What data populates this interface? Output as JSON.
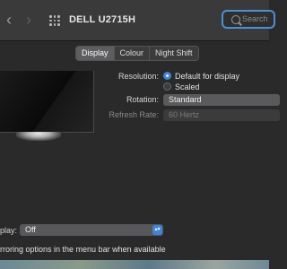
{
  "window": {
    "title": "DELL U2715H",
    "nav_back": "‹",
    "nav_forward": "›",
    "search_placeholder": "Search"
  },
  "tabs": [
    {
      "label": "Display",
      "active": true
    },
    {
      "label": "Colour",
      "active": false
    },
    {
      "label": "Night Shift",
      "active": false
    }
  ],
  "settings": {
    "resolution_label": "Resolution:",
    "resolution_options": [
      {
        "label": "Default for display",
        "selected": true
      },
      {
        "label": "Scaled",
        "selected": false
      }
    ],
    "rotation_label": "Rotation:",
    "rotation_value": "Standard",
    "refresh_label": "Refresh Rate:",
    "refresh_value": "60 Hertz"
  },
  "airplay": {
    "label": "play:",
    "value": "Off"
  },
  "mirroring": {
    "text": "rroring options in the menu bar when available"
  },
  "colors": {
    "accent": "#3d85d8",
    "background": "#2a2a2b",
    "toolbar": "#3a3a3b"
  },
  "icons": {
    "grid": "grid-icon",
    "search": "search-icon",
    "chevron": "chevron-updown-icon"
  }
}
